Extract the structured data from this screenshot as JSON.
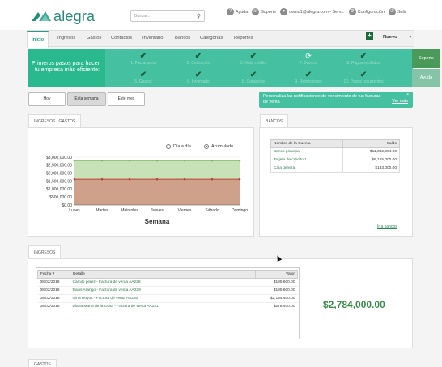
{
  "brand": {
    "name": "alegra"
  },
  "search": {
    "placeholder": "Buscar..."
  },
  "top_links": {
    "help": "Ayuda",
    "support": "Soporte",
    "user": "demo1@alegra.com - Serv...",
    "settings": "Configuración",
    "logout": "Salir"
  },
  "nav": [
    "Inicio",
    "Ingresos",
    "Gastos",
    "Contactos",
    "Inventario",
    "Bancos",
    "Categorías",
    "Reportes"
  ],
  "new_button": {
    "label": "Nuevo"
  },
  "onboarding": {
    "title": "Primeros pasos para hacer tu empresa más eficiente:",
    "steps_row1": [
      {
        "label": "1. Facturación",
        "done": true
      },
      {
        "label": "2. Cotización",
        "done": true
      },
      {
        "label": "3. Nota crédito",
        "done": true
      },
      {
        "label": "7. Bancos",
        "done": false
      },
      {
        "label": "8. Pagos recibidos",
        "done": true
      }
    ],
    "steps_row2": [
      {
        "label": "5. Gastos",
        "done": true
      },
      {
        "label": "6. Inventario",
        "done": true
      },
      {
        "label": "8. Contactos",
        "done": true
      },
      {
        "label": "9. Retenciones",
        "done": true
      },
      {
        "label": "10. Pagos recurrentes",
        "done": true
      }
    ],
    "support_btn": "Soporte",
    "help_btn": "Ayuda",
    "close": "×"
  },
  "period_buttons": {
    "today": "Hoy",
    "week": "Esta semana",
    "month": "Este mes"
  },
  "notification": {
    "text": "Personaliza las notificaciones de vencimiento de tus facturas de venta",
    "link": "Ver más",
    "close": "×"
  },
  "income_expense_tab": "INGRESOS / GASTOS",
  "chart_legend": {
    "daily": "Día a día",
    "cumulative": "Acumulado"
  },
  "chart_data": {
    "type": "area",
    "xlabel": "Semana",
    "categories": [
      "Lunes",
      "Martes",
      "Miércoles",
      "Jueves",
      "Viernes",
      "Sábado",
      "Domingo"
    ],
    "y_ticks": [
      "$0.00",
      "$500,000.00",
      "$1,000,000.00",
      "$1,500,000.00",
      "$2,000,000.00",
      "$2,500,000.00",
      "$3,000,000.00"
    ],
    "ylim": [
      0,
      3000000
    ],
    "series": [
      {
        "values": [
          2784000,
          2784000,
          2784000,
          2784000,
          2784000,
          2784000,
          2784000
        ],
        "color": "#7fbf6a",
        "fill": "#c8e2b8"
      },
      {
        "values": [
          1620000,
          1620000,
          1620000,
          1620000,
          1620000,
          1620000,
          1620000
        ],
        "color": "#b8413a",
        "fill": "#cfa08a"
      }
    ]
  },
  "banks": {
    "tab": "BANCOS",
    "headers": [
      "Nombre de la Cuenta",
      "Saldo"
    ],
    "rows": [
      {
        "name": "Banco principal",
        "balance": "-$11,332,994.00"
      },
      {
        "name": "Tarjeta de crédito 1",
        "balance": "$6,125,000.00"
      },
      {
        "name": "Caja general",
        "balance": "$133,000.00"
      }
    ],
    "link": "Ir a bancos"
  },
  "income": {
    "tab": "INGRESOS",
    "headers": [
      "Fecha ▾",
      "Detalle",
      "Valor"
    ],
    "rows": [
      {
        "date": "08/02/2016",
        "detail": "Camilo perez - Factura de venta AA228",
        "value": "$185,600.00"
      },
      {
        "date": "08/02/2016",
        "detail": "Davis Arango - Factura de venta AA229",
        "value": "$185,600.00"
      },
      {
        "date": "08/02/2016",
        "detail": "Gina Hoyos - Factura de venta AA230",
        "value": "$2,134,400.00"
      },
      {
        "date": "08/02/2016",
        "detail": "Diana María de la Ossa - Factura de venta AA231",
        "value": "$278,400.00"
      }
    ],
    "total": "$2,784,000.00"
  },
  "expenses_tab": "GASTOS",
  "colors": {
    "accent": "#2a9a8a",
    "onboarding": "#45c0a0",
    "positive": "#3a8a4a"
  }
}
